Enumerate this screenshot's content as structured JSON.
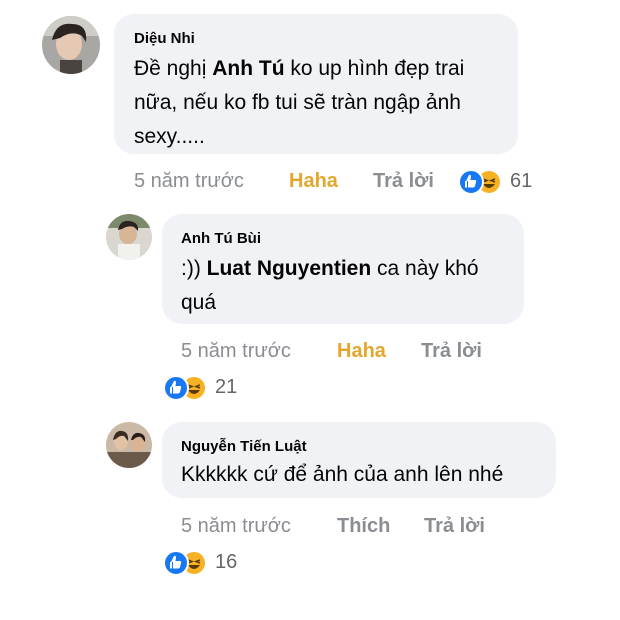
{
  "comments": [
    {
      "author": "Diệu Nhi",
      "text_pre": "Đề nghị ",
      "mention": "Anh Tú",
      "text_post_line1": " ko up hình đẹp trai",
      "line2": "nữa, nếu ko fb tui sẽ tràn ngập ảnh",
      "line3": "sexy.....",
      "time": "5 năm trước",
      "reaction_label": "Haha",
      "reply_label": "Trả lời",
      "reaction_count": "61"
    },
    {
      "author": "Anh Tú Bùi",
      "text_pre": ":)) ",
      "mention": "Luat Nguyentien",
      "text_post_line1": " ca này khó",
      "line2": "quá",
      "time": "5 năm trước",
      "reaction_label": "Haha",
      "reply_label": "Trả lời",
      "reaction_count": "21"
    },
    {
      "author": "Nguyễn Tiến Luật",
      "line1": "Kkkkkk cứ để ảnh của anh lên nhé",
      "time": "5 năm trước",
      "reaction_label": "Thích",
      "reply_label": "Trả lời",
      "reaction_count": "16"
    }
  ],
  "icons": {
    "like": "like-reaction-icon",
    "haha": "haha-reaction-icon"
  },
  "colors": {
    "bubble": "#f0f2f5",
    "haha_active": "#e4a62d",
    "like_blue": "#1877f2",
    "haha_yellow": "#f7b125",
    "meta_gray": "#8a8d91"
  }
}
